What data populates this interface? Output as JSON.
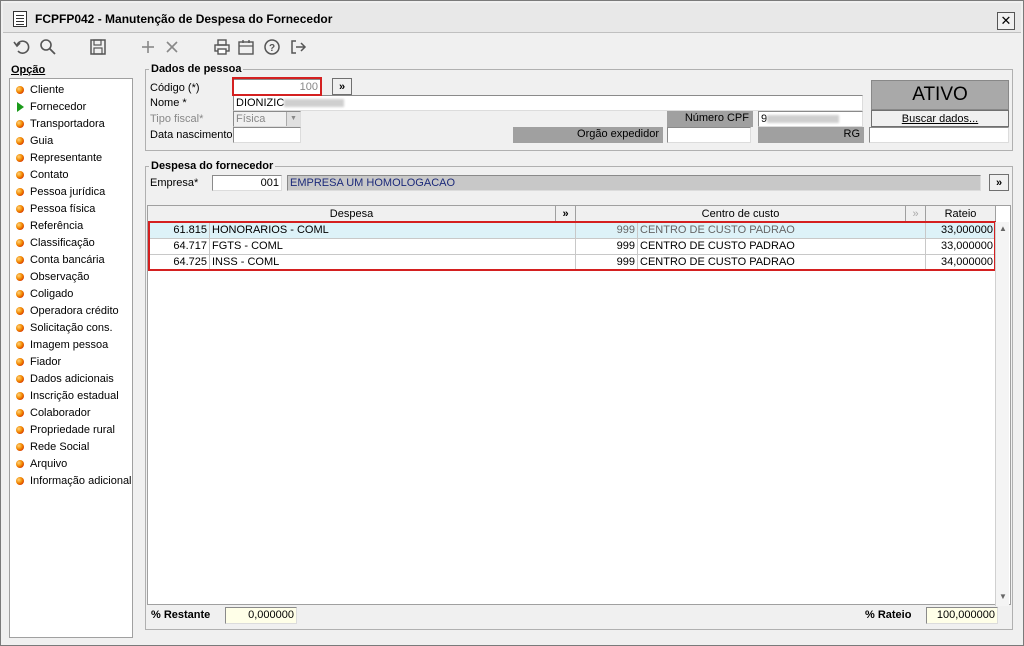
{
  "window": {
    "title": "FCPFP042 - Manutenção de Despesa do Fornecedor",
    "close_label": "✕"
  },
  "toolbar": {
    "icons": [
      "undo-icon",
      "search-icon",
      "save-icon",
      "add-icon",
      "delete-icon",
      "print-icon",
      "calendar-icon",
      "help-icon",
      "exit-icon"
    ]
  },
  "sidebar": {
    "title": "Opção",
    "items": [
      {
        "label": "Cliente"
      },
      {
        "label": "Fornecedor"
      },
      {
        "label": "Transportadora"
      },
      {
        "label": "Guia"
      },
      {
        "label": "Representante"
      },
      {
        "label": "Contato"
      },
      {
        "label": "Pessoa jurídica"
      },
      {
        "label": "Pessoa física"
      },
      {
        "label": "Referência"
      },
      {
        "label": "Classificação"
      },
      {
        "label": "Conta bancária"
      },
      {
        "label": "Observação"
      },
      {
        "label": "Coligado"
      },
      {
        "label": "Operadora crédito"
      },
      {
        "label": "Solicitação cons."
      },
      {
        "label": "Imagem pessoa"
      },
      {
        "label": "Fiador"
      },
      {
        "label": "Dados adicionais"
      },
      {
        "label": "Inscrição estadual"
      },
      {
        "label": "Colaborador"
      },
      {
        "label": "Propriedade rural"
      },
      {
        "label": "Rede Social"
      },
      {
        "label": "Arquivo"
      },
      {
        "label": "Informação adicional"
      }
    ],
    "active_index": 1
  },
  "dados_pessoa": {
    "title": "Dados de pessoa",
    "codigo_label": "Código (*)",
    "codigo_value": "100",
    "nome_label": "Nome *",
    "nome_value": "DIONIZIC",
    "tipo_fiscal_label": "Tipo fiscal*",
    "tipo_fiscal_value": "Física",
    "data_nascimento_label": "Data nascimento",
    "numero_cpf_label": "Número CPF",
    "cpf_value": "9",
    "orgao_expedidor_label": "Orgão expedidor",
    "rg_label": "RG",
    "status": "ATIVO",
    "buscar_label": "Buscar dados...",
    "more_label": "»"
  },
  "despesa": {
    "title": "Despesa do fornecedor",
    "empresa_label": "Empresa*",
    "empresa_code": "001",
    "empresa_name": "EMPRESA UM HOMOLOGACAO",
    "more_label": "»"
  },
  "grid": {
    "headers": {
      "despesa": "Despesa",
      "centro": "Centro de custo",
      "rateio": "Rateio",
      "more": "»",
      "more2": "»"
    },
    "rows": [
      {
        "code": "61.815",
        "despesa": "HONORARIOS - COML",
        "cc_code": "999",
        "centro": "CENTRO DE CUSTO PADRAO",
        "rateio": "33,000000"
      },
      {
        "code": "64.717",
        "despesa": "FGTS - COML",
        "cc_code": "999",
        "centro": "CENTRO DE CUSTO PADRAO",
        "rateio": "33,000000"
      },
      {
        "code": "64.725",
        "despesa": "INSS - COML",
        "cc_code": "999",
        "centro": "CENTRO DE CUSTO PADRAO",
        "rateio": "34,000000"
      }
    ]
  },
  "footer": {
    "restante_label": "% Restante",
    "restante_value": "0,000000",
    "rateio_label": "% Rateio",
    "rateio_value": "100,000000"
  },
  "colors": {
    "highlight": "#d42020",
    "selected_row": "#ddf2f8",
    "status_bg": "#a9a9a9"
  }
}
